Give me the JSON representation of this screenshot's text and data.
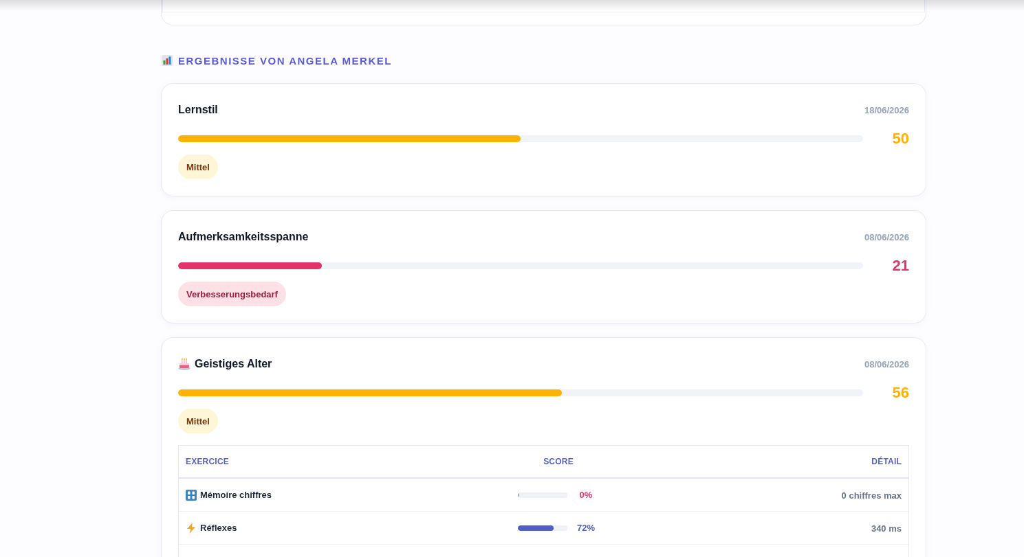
{
  "section": {
    "title": "ERGEBNISSE VON ANGELA MERKEL"
  },
  "results": [
    {
      "title": "Lernstil",
      "date": "18/06/2026",
      "level": 0.5,
      "score": "50",
      "badge": "Mittel"
    },
    {
      "title": "Aufmerksamkeitsspanne",
      "date": "08/06/2026",
      "level": 0.21,
      "score": "21",
      "badge": "Verbesserungsbedarf"
    },
    {
      "title": "Geistiges Alter",
      "date": "08/06/2026",
      "level": 0.56,
      "score": "56",
      "badge": "Mittel",
      "table": {
        "columns": [
          "EXERCICE",
          "SCORE",
          "DÉTAIL"
        ],
        "rows": [
          {
            "exercise": "Mémoire chiffres",
            "level": 0,
            "score": "0%",
            "detail": "0 chiffres max"
          },
          {
            "exercise": "Réflexes",
            "level": 0.72,
            "score": "72%",
            "detail": "340 ms"
          }
        ]
      }
    }
  ]
}
